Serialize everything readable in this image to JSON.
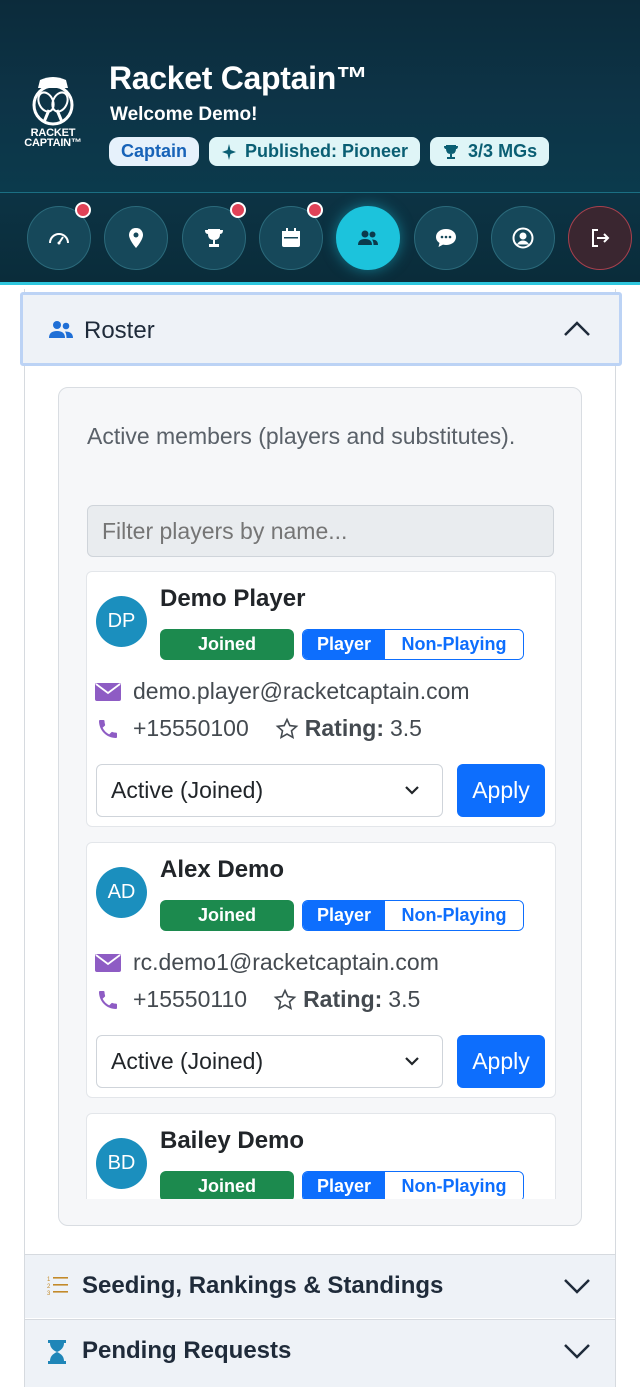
{
  "header": {
    "title": "Racket Captain™",
    "welcome": "Welcome Demo!",
    "logo_text_1": "RACKET",
    "logo_text_2": "CAPTAIN™",
    "badges": {
      "role": "Captain",
      "published": "Published: Pioneer",
      "mgs": "3/3 MGs"
    }
  },
  "nav": {
    "items": [
      {
        "icon": "dashboard-icon",
        "notify": true
      },
      {
        "icon": "location-icon",
        "notify": false
      },
      {
        "icon": "trophy-icon",
        "notify": true
      },
      {
        "icon": "calendar-icon",
        "notify": true
      },
      {
        "icon": "roster-icon",
        "notify": false,
        "active": true
      },
      {
        "icon": "chat-icon",
        "notify": false
      },
      {
        "icon": "profile-icon",
        "notify": false
      },
      {
        "icon": "logout-icon",
        "notify": false
      }
    ]
  },
  "roster": {
    "title": "Roster",
    "intro": "Active members (players and substitutes).",
    "filter_placeholder": "Filter players by name...",
    "players": [
      {
        "initials": "DP",
        "name": "Demo Player",
        "status_badge": "Joined",
        "role": "Player",
        "type": "Non-Playing",
        "email": "demo.player@racketcaptain.com",
        "phone": "+15550100",
        "rating_label": "Rating:",
        "rating": "3.5",
        "status_value": "Active (Joined)",
        "apply_label": "Apply"
      },
      {
        "initials": "AD",
        "name": "Alex Demo",
        "status_badge": "Joined",
        "role": "Player",
        "type": "Non-Playing",
        "email": "rc.demo1@racketcaptain.com",
        "phone": "+15550110",
        "rating_label": "Rating:",
        "rating": "3.5",
        "status_value": "Active (Joined)",
        "apply_label": "Apply"
      },
      {
        "initials": "BD",
        "name": "Bailey Demo",
        "status_badge": "Joined",
        "role": "Player",
        "type": "Non-Playing"
      }
    ]
  },
  "sections": {
    "seeding": "Seeding, Rankings & Standings",
    "pending": "Pending Requests"
  },
  "colors": {
    "accent": "#1cc3dc",
    "primary": "#0d6efd",
    "joined": "#1c8a4e",
    "notify": "#e04257"
  }
}
